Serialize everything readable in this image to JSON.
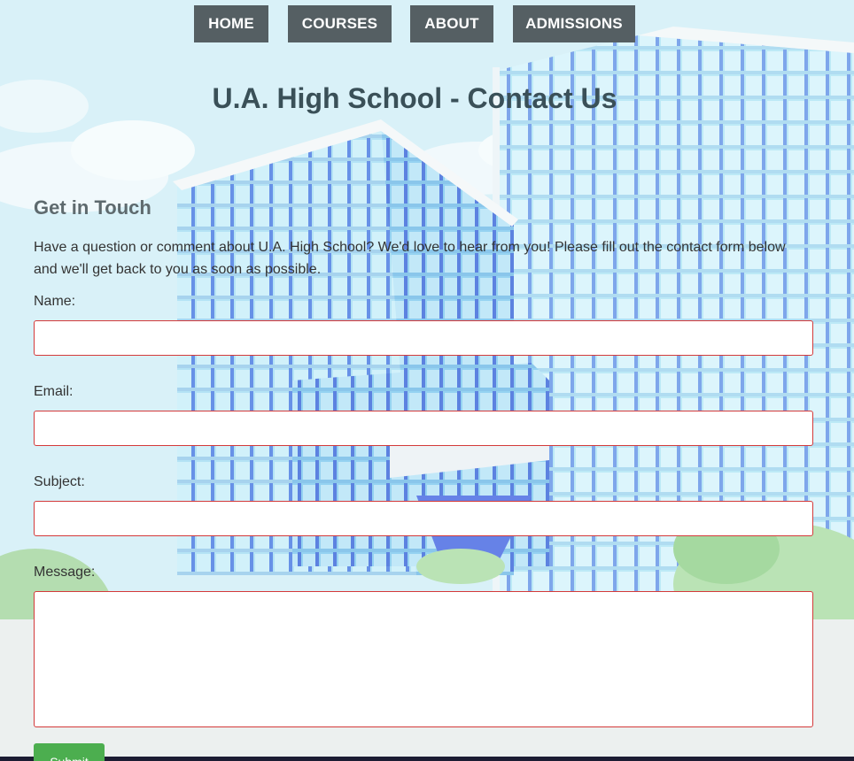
{
  "nav": {
    "items": [
      {
        "label": "HOME"
      },
      {
        "label": "COURSES"
      },
      {
        "label": "ABOUT"
      },
      {
        "label": "ADMISSIONS"
      }
    ]
  },
  "page": {
    "title": "U.A. High School - Contact Us"
  },
  "contact": {
    "heading": "Get in Touch",
    "intro": "Have a question or comment about U.A. High School? We'd love to hear from you! Please fill out the contact form below and we'll get back to you as soon as possible."
  },
  "form": {
    "name_label": "Name:",
    "name_value": "",
    "email_label": "Email:",
    "email_value": "",
    "subject_label": "Subject:",
    "subject_value": "",
    "message_label": "Message:",
    "message_value": "",
    "submit_label": "Submit"
  },
  "colors": {
    "nav_background": "#555f63",
    "title": "#3a5058",
    "input_border": "#d43a3a",
    "submit_background": "#4cae4f"
  }
}
